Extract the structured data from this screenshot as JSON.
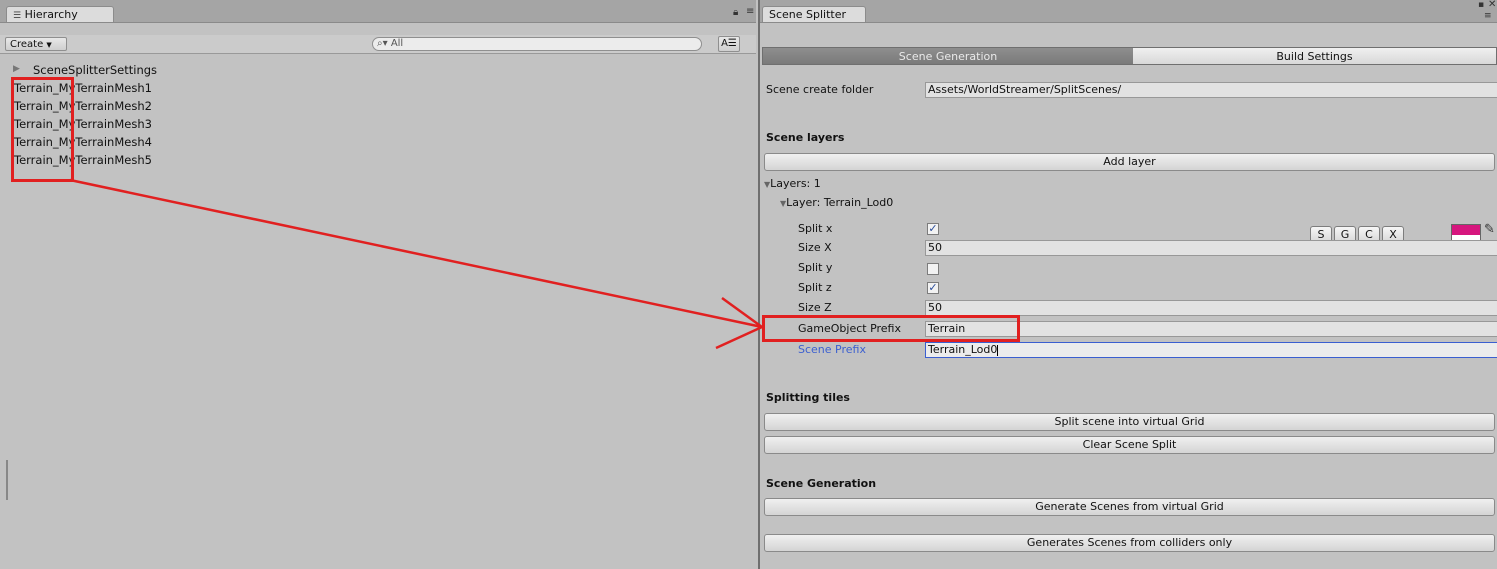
{
  "hierarchy": {
    "tab_title": "Hierarchy",
    "create_label": "Create",
    "search_placeholder": "All",
    "rows": [
      "SceneSplitterSettings",
      "Terrain_MyTerrainMesh1",
      "Terrain_MyTerrainMesh2",
      "Terrain_MyTerrainMesh3",
      "Terrain_MyTerrainMesh4",
      "Terrain_MyTerrainMesh5"
    ]
  },
  "splitter": {
    "tab_title": "Scene Splitter",
    "tabs": [
      "Scene Generation",
      "Build Settings"
    ],
    "scene_create_folder_label": "Scene create folder",
    "scene_create_folder_value": "Assets/WorldStreamer/SplitScenes/",
    "scene_layers_header": "Scene layers",
    "add_layer_button": "Add layer",
    "layers_label": "Layers: 1",
    "layer_label": "Layer: Terrain_Lod0",
    "layer_buttons": [
      "S",
      "G",
      "C",
      "X"
    ],
    "layer_color": "#d6167e",
    "split_x_label": "Split x",
    "split_x_checked": true,
    "size_x_label": "Size X",
    "size_x_value": "50",
    "split_y_label": "Split y",
    "split_y_checked": false,
    "split_z_label": "Split z",
    "split_z_checked": true,
    "size_z_label": "Size Z",
    "size_z_value": "50",
    "go_prefix_label": "GameObject Prefix",
    "go_prefix_value": "Terrain",
    "scene_prefix_label": "Scene Prefix",
    "scene_prefix_value": "Terrain_Lod0",
    "splitting_tiles_header": "Splitting tiles",
    "split_grid_button": "Split scene into virtual Grid",
    "clear_split_button": "Clear Scene Split",
    "scene_generation_header": "Scene Generation",
    "generate_grid_button": "Generate Scenes from virtual Grid",
    "generate_colliders_button": "Generates Scenes from colliders only"
  },
  "colors": {
    "annotation_red": "#e12020",
    "focus_blue": "#3b5fd0"
  }
}
